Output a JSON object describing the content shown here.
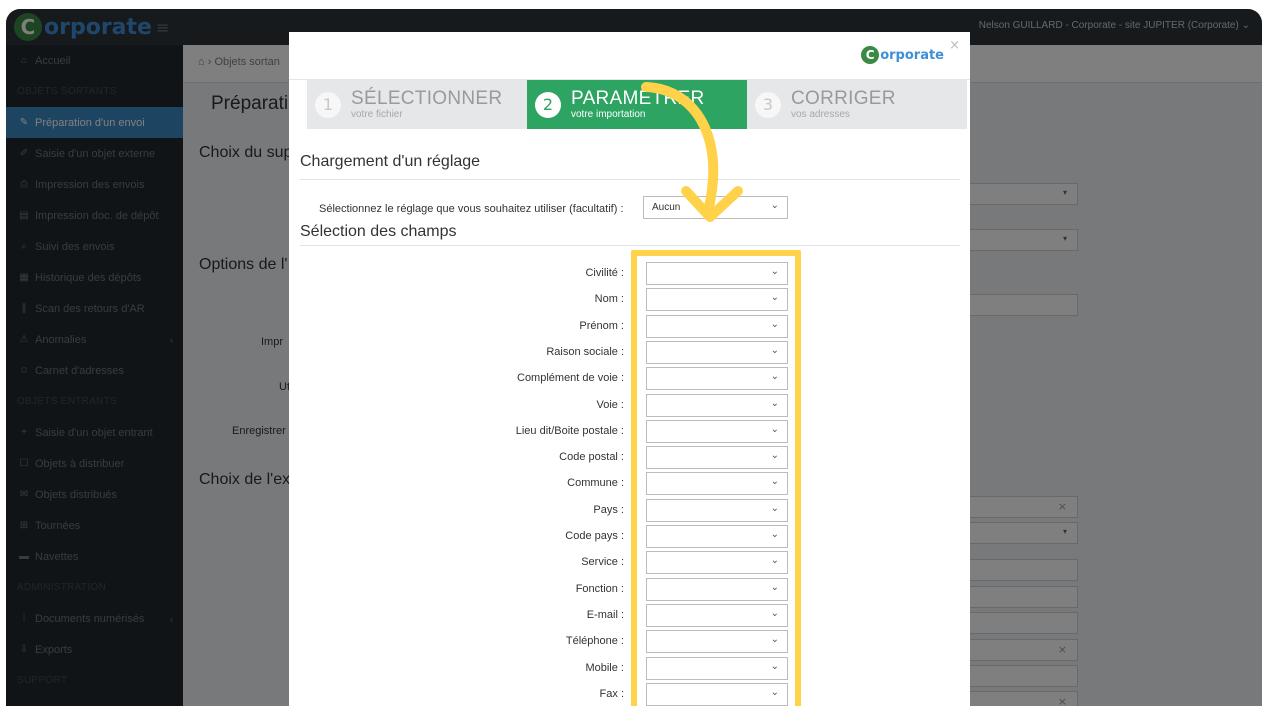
{
  "app": {
    "logo_letter": "C",
    "logo_text": "orporate",
    "user_menu": "Nelson GUILLARD - Corporate - site JUPITER (Corporate)"
  },
  "sidebar": {
    "items": [
      {
        "label": "Accueil",
        "icon": "home-icon"
      },
      {
        "label": "OBJETS SORTANTS",
        "section": true
      },
      {
        "label": "Préparation d'un envoi",
        "icon": "pencil-icon",
        "active": true
      },
      {
        "label": "Saisie d'un objet externe",
        "icon": "edit-icon"
      },
      {
        "label": "Impression des envois",
        "icon": "print-icon"
      },
      {
        "label": "Impression doc. de dépôt",
        "icon": "document-icon"
      },
      {
        "label": "Suivi des envois",
        "icon": "search-icon"
      },
      {
        "label": "Historique des dépôts",
        "icon": "calendar-icon"
      },
      {
        "label": "Scan des retours d'AR",
        "icon": "barcode-icon"
      },
      {
        "label": "Anomalies",
        "icon": "warning-icon",
        "chevron": true
      },
      {
        "label": "Carnet d'adresses",
        "icon": "users-icon"
      },
      {
        "label": "OBJETS ENTRANTS",
        "section": true
      },
      {
        "label": "Saisie d'un objet entrant",
        "icon": "plus-icon"
      },
      {
        "label": "Objets à distribuer",
        "icon": "box-icon"
      },
      {
        "label": "Objets distribués",
        "icon": "envelope-icon"
      },
      {
        "label": "Tournées",
        "icon": "cart-icon"
      },
      {
        "label": "Navettes",
        "icon": "truck-icon"
      },
      {
        "label": "ADMINISTRATION",
        "section": true
      },
      {
        "label": "Documents numérisés",
        "icon": "grid-icon",
        "chevron": true
      },
      {
        "label": "Exports",
        "icon": "export-icon"
      },
      {
        "label": "SUPPORT",
        "section": true
      }
    ]
  },
  "main": {
    "breadcrumb": "Objets sortan",
    "page_title": "Préparatio",
    "section1": "Choix du sup",
    "section2": "Options de l'",
    "section3": "Choix de l'ex",
    "labels": [
      "Impr",
      "Ut",
      "Enregistrer le"
    ]
  },
  "modal": {
    "logo_letter": "C",
    "logo_text": "orporate",
    "close": "×",
    "steps": [
      {
        "num": "1",
        "title": "SÉLECTIONNER",
        "sub": "votre fichier"
      },
      {
        "num": "2",
        "title": "PARAMÉTRER",
        "sub": "votre importation"
      },
      {
        "num": "3",
        "title": "CORRIGER",
        "sub": "vos adresses"
      }
    ],
    "reglage_heading": "Chargement d'un réglage",
    "reglage_label": "Sélectionnez le réglage que vous souhaitez utiliser (facultatif) :",
    "reglage_value": "Aucun",
    "fields_heading": "Sélection des champs",
    "fields": [
      "Civilité :",
      "Nom :",
      "Prénom :",
      "Raison sociale :",
      "Complément de voie :",
      "Voie :",
      "Lieu dit/Boite postale :",
      "Code postal :",
      "Commune :",
      "Pays :",
      "Code pays :",
      "Service :",
      "Fonction :",
      "E-mail :",
      "Téléphone :",
      "Mobile :",
      "Fax :"
    ]
  },
  "colors": {
    "active_step": "#2ea463",
    "highlight": "#ffd24a",
    "sidebar_active": "#3b8bc4"
  }
}
